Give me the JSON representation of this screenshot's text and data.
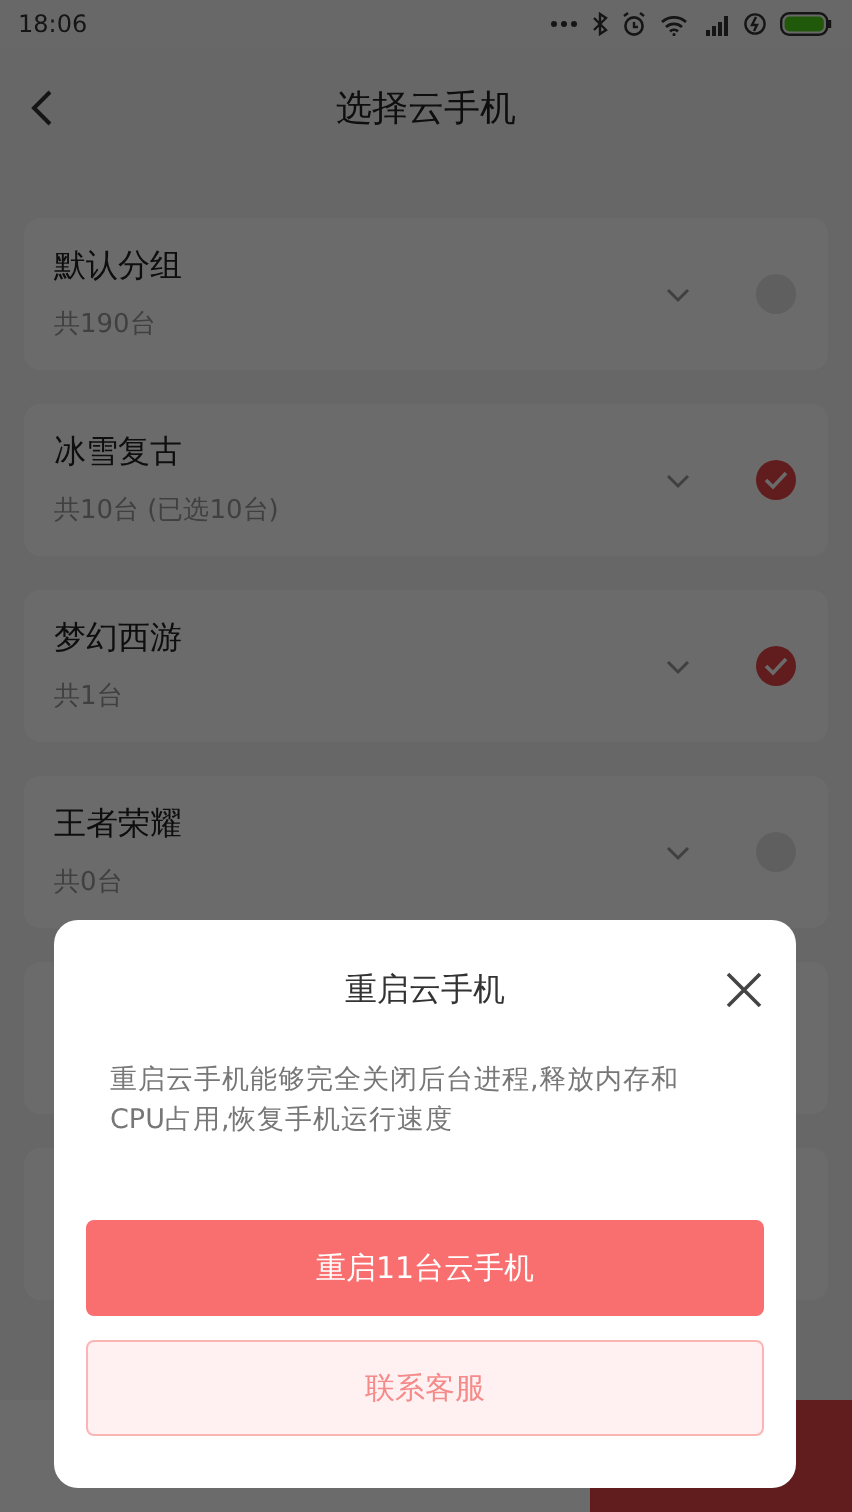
{
  "status_bar": {
    "time": "18:06"
  },
  "header": {
    "title": "选择云手机"
  },
  "groups": [
    {
      "name": "默认分组",
      "count": "共190台",
      "selected": false
    },
    {
      "name": "冰雪复古",
      "count": "共10台 (已选10台)",
      "selected": true
    },
    {
      "name": "梦幻西游",
      "count": "共1台",
      "selected": true
    },
    {
      "name": "王者荣耀",
      "count": "共0台",
      "selected": false
    }
  ],
  "dialog": {
    "title": "重启云手机",
    "message": "重启云手机能够完全关闭后台进程,释放内存和CPU占用,恢复手机运行速度",
    "primary_button": "重启11台云手机",
    "secondary_button": "联系客服"
  }
}
